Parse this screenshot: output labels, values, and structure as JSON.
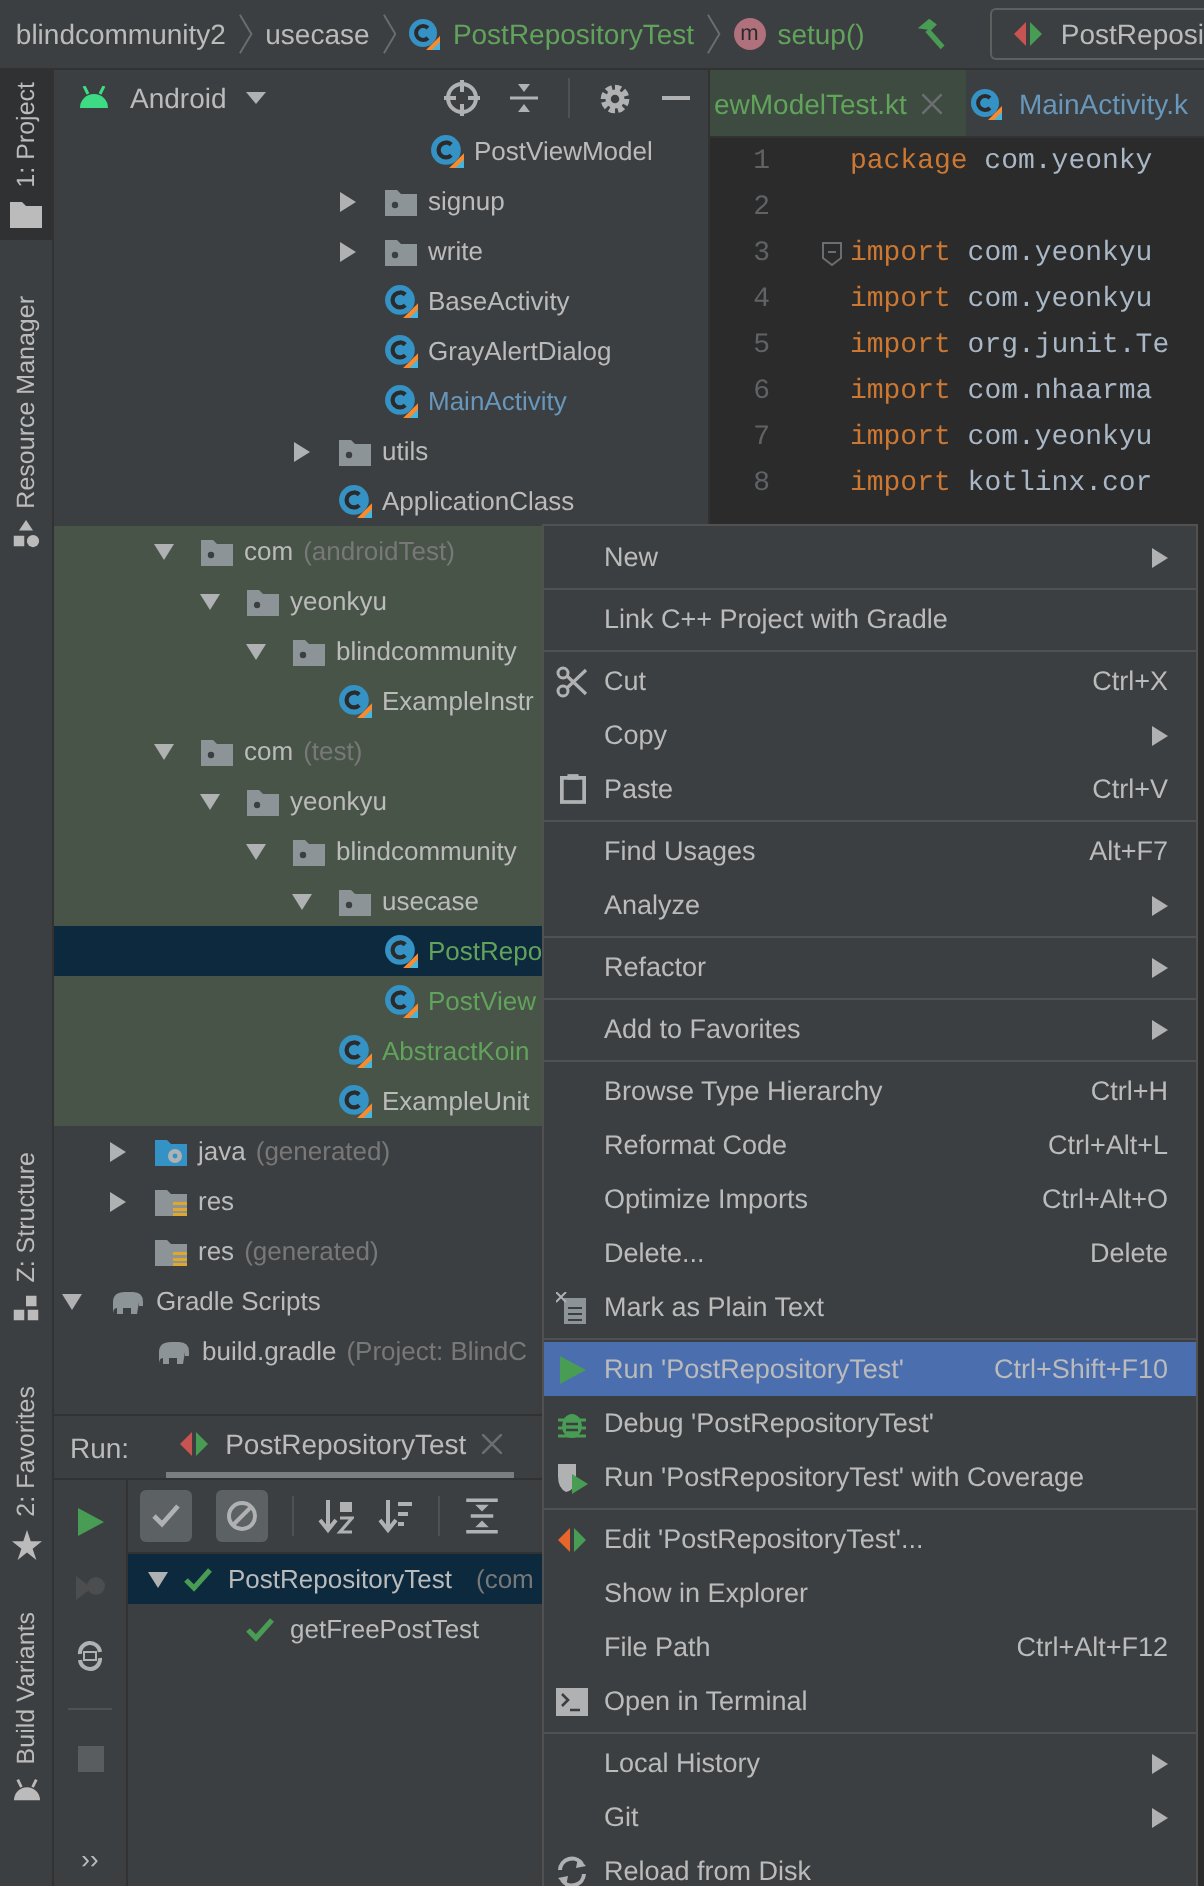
{
  "breadcrumbs": [
    {
      "label": "blindcommunity2",
      "kind": "folder",
      "color": "#bbbbbb"
    },
    {
      "label": "usecase",
      "kind": "folder",
      "color": "#bbbbbb"
    },
    {
      "label": "PostRepositoryTest",
      "kind": "class",
      "color": "#62a35c"
    },
    {
      "label": "setup()",
      "kind": "method",
      "badge": "m",
      "color": "#62a35c"
    }
  ],
  "run_config": {
    "label": "PostReposi"
  },
  "sidebar": [
    {
      "label": "1: Project",
      "kind": "project",
      "selected": true
    },
    {
      "label": "Resource Manager",
      "kind": "resources",
      "selected": false
    },
    {
      "label": "Z: Structure",
      "kind": "structure",
      "selected": false
    },
    {
      "label": "2: Favorites",
      "kind": "favorites",
      "selected": false
    },
    {
      "label": "Build Variants",
      "kind": "variants",
      "selected": false
    }
  ],
  "project": {
    "view": "Android",
    "tree": [
      {
        "children": [
          {
            "children": [
              {
                "children": [
                  {
                    "children": [
                      {
                        "children": [
                          {
                            "children": [
                              {
                                "children": [
                                  {
                                    "label": "PostViewModel",
                                    "kind": "file",
                                    "color": "#bbbbbb",
                                    "highlighted": false,
                                    "selected": false
                                  }
                                ]
                              },
                              {
                                "label": "signup",
                                "kind": "folder",
                                "expanded": false,
                                "color": "#bbbbbb",
                                "highlighted": false,
                                "selected": false
                              },
                              {
                                "label": "write",
                                "kind": "folder",
                                "expanded": false,
                                "color": "#bbbbbb",
                                "highlighted": false,
                                "selected": false
                              },
                              {
                                "label": "BaseActivity",
                                "kind": "file",
                                "color": "#bbbbbb",
                                "highlighted": false,
                                "selected": false
                              },
                              {
                                "label": "GrayAlertDialog",
                                "kind": "file",
                                "color": "#bbbbbb",
                                "highlighted": false,
                                "selected": false
                              },
                              {
                                "label": "MainActivity",
                                "kind": "file",
                                "color": "#6897bb",
                                "highlighted": false,
                                "selected": false
                              }
                            ]
                          },
                          {
                            "label": "utils",
                            "kind": "folder",
                            "expanded": false,
                            "color": "#bbbbbb",
                            "highlighted": false,
                            "selected": false
                          },
                          {
                            "label": "ApplicationClass",
                            "kind": "file",
                            "color": "#bbbbbb",
                            "highlighted": false,
                            "selected": false
                          }
                        ]
                      }
                    ]
                  }
                ]
              },
              {
                "label": "com",
                "note": "(androidTest)",
                "kind": "folder",
                "expanded": true,
                "color": "#bbbbbb",
                "highlighted": true,
                "selected": false,
                "children": [
                  {
                    "label": "yeonkyu",
                    "kind": "folder",
                    "expanded": true,
                    "color": "#bbbbbb",
                    "highlighted": true,
                    "selected": false,
                    "children": [
                      {
                        "label": "blindcommunity",
                        "kind": "folder",
                        "expanded": true,
                        "color": "#bbbbbb",
                        "highlighted": true,
                        "selected": false,
                        "children": [
                          {
                            "label": "ExampleInstr",
                            "kind": "file",
                            "color": "#bbbbbb",
                            "highlighted": true,
                            "selected": false
                          }
                        ]
                      }
                    ]
                  }
                ]
              },
              {
                "label": "com",
                "note": "(test)",
                "kind": "folder",
                "expanded": true,
                "color": "#bbbbbb",
                "highlighted": true,
                "selected": false,
                "children": [
                  {
                    "label": "yeonkyu",
                    "kind": "folder",
                    "expanded": true,
                    "color": "#bbbbbb",
                    "highlighted": true,
                    "selected": false,
                    "children": [
                      {
                        "label": "blindcommunity",
                        "kind": "folder",
                        "expanded": true,
                        "color": "#bbbbbb",
                        "highlighted": true,
                        "selected": false,
                        "children": [
                          {
                            "label": "usecase",
                            "kind": "folder",
                            "expanded": true,
                            "color": "#bbbbbb",
                            "highlighted": true,
                            "selected": false,
                            "children": [
                              {
                                "label": "PostRepo",
                                "kind": "file",
                                "color": "#62a35c",
                                "highlighted": true,
                                "selected": true
                              },
                              {
                                "label": "PostView",
                                "kind": "file",
                                "color": "#62a35c",
                                "highlighted": true,
                                "selected": false
                              }
                            ]
                          },
                          {
                            "label": "AbstractKoin",
                            "kind": "file",
                            "color": "#62a35c",
                            "highlighted": true,
                            "selected": false
                          },
                          {
                            "label": "ExampleUnit",
                            "kind": "file",
                            "color": "#bbbbbb",
                            "highlighted": true,
                            "selected": false
                          }
                        ]
                      }
                    ]
                  }
                ]
              }
            ]
          },
          {
            "label": "java",
            "note": "(generated)",
            "kind": "gen-folder",
            "expanded": false,
            "color": "#bbbbbb",
            "highlighted": false,
            "selected": false
          },
          {
            "label": "res",
            "kind": "res-folder",
            "expanded": false,
            "color": "#bbbbbb",
            "highlighted": false,
            "selected": false
          },
          {
            "label": "res",
            "note": "(generated)",
            "kind": "res-folder",
            "color": "#bbbbbb",
            "highlighted": false,
            "selected": false
          }
        ]
      },
      {
        "label": "Gradle Scripts",
        "kind": "gradle",
        "expanded": true,
        "color": "#bbbbbb",
        "highlighted": false,
        "selected": false,
        "children": [
          {
            "label": "build.gradle",
            "note": "(Project: BlindC",
            "kind": "gradle-file",
            "color": "#bbbbbb",
            "highlighted": false,
            "selected": false
          }
        ]
      }
    ]
  },
  "editor": {
    "tabs": [
      {
        "label": "ewModelTest.kt",
        "kind": "plain",
        "color": "#62a35c",
        "scoped": true
      },
      {
        "label": "MainActivity.k",
        "kind": "class",
        "color": "#6897bb",
        "scoped": false
      }
    ],
    "lines": [
      {
        "number": "1",
        "keyword": "package",
        "rest": "com.yeonky"
      },
      {
        "number": "2"
      },
      {
        "number": "3",
        "keyword": "import",
        "rest": "com.yeonkyu",
        "fold": true
      },
      {
        "number": "4",
        "keyword": "import",
        "rest": "com.yeonkyu"
      },
      {
        "number": "5",
        "keyword": "import",
        "rest": "org.junit.Te"
      },
      {
        "number": "6",
        "keyword": "import",
        "rest": "com.nhaarma"
      },
      {
        "number": "7",
        "keyword": "import",
        "rest": "com.yeonkyu"
      },
      {
        "number": "8",
        "keyword": "import",
        "rest": "kotlinx.cor"
      }
    ]
  },
  "run": {
    "label": "Run:",
    "tab": "PostRepositoryTest",
    "filters": [
      {
        "kind": "passed",
        "on": true
      },
      {
        "kind": "ignored",
        "on": true
      }
    ],
    "results": [
      {
        "label": "PostRepositoryTest",
        "note": "(com",
        "passed": true,
        "selected": true,
        "children": [
          {
            "label": "getFreePostTest",
            "passed": true,
            "selected": false
          }
        ]
      }
    ],
    "more": "››"
  },
  "menu": [
    [
      {
        "label": "New",
        "submenu": true,
        "kind": "plain",
        "selected": false
      }
    ],
    [
      {
        "label": "Link C++ Project with Gradle",
        "kind": "plain",
        "selected": false
      }
    ],
    [
      {
        "label": "Cut",
        "shortcut": "Ctrl+X",
        "kind": "cut",
        "selected": false
      },
      {
        "label": "Copy",
        "submenu": true,
        "kind": "plain",
        "selected": false
      },
      {
        "label": "Paste",
        "shortcut": "Ctrl+V",
        "kind": "paste",
        "selected": false
      }
    ],
    [
      {
        "label": "Find Usages",
        "shortcut": "Alt+F7",
        "kind": "plain",
        "selected": false
      },
      {
        "label": "Analyze",
        "submenu": true,
        "kind": "plain",
        "selected": false
      }
    ],
    [
      {
        "label": "Refactor",
        "submenu": true,
        "kind": "plain",
        "selected": false
      }
    ],
    [
      {
        "label": "Add to Favorites",
        "submenu": true,
        "kind": "plain",
        "selected": false
      }
    ],
    [
      {
        "label": "Browse Type Hierarchy",
        "shortcut": "Ctrl+H",
        "kind": "plain",
        "selected": false
      },
      {
        "label": "Reformat Code",
        "shortcut": "Ctrl+Alt+L",
        "kind": "plain",
        "selected": false
      },
      {
        "label": "Optimize Imports",
        "shortcut": "Ctrl+Alt+O",
        "kind": "plain",
        "selected": false
      },
      {
        "label": "Delete...",
        "shortcut": "Delete",
        "kind": "plain",
        "selected": false
      },
      {
        "label": "Mark as Plain Text",
        "kind": "plain-text",
        "selected": false
      }
    ],
    [
      {
        "label": "Run 'PostRepositoryTest'",
        "shortcut": "Ctrl+Shift+F10",
        "kind": "run",
        "selected": true
      },
      {
        "label": "Debug 'PostRepositoryTest'",
        "kind": "debug",
        "selected": false
      },
      {
        "label": "Run 'PostRepositoryTest' with Coverage",
        "kind": "coverage",
        "selected": false
      }
    ],
    [
      {
        "label": "Edit 'PostRepositoryTest'...",
        "kind": "edit-config",
        "selected": false
      },
      {
        "label": "Show in Explorer",
        "kind": "plain",
        "selected": false
      },
      {
        "label": "File Path",
        "shortcut": "Ctrl+Alt+F12",
        "kind": "plain",
        "selected": false
      },
      {
        "label": "Open in Terminal",
        "kind": "terminal",
        "selected": false
      }
    ],
    [
      {
        "label": "Local History",
        "submenu": true,
        "kind": "plain",
        "selected": false
      },
      {
        "label": "Git",
        "submenu": true,
        "kind": "plain",
        "selected": false
      },
      {
        "label": "Reload from Disk",
        "kind": "reload",
        "selected": false
      }
    ]
  ]
}
